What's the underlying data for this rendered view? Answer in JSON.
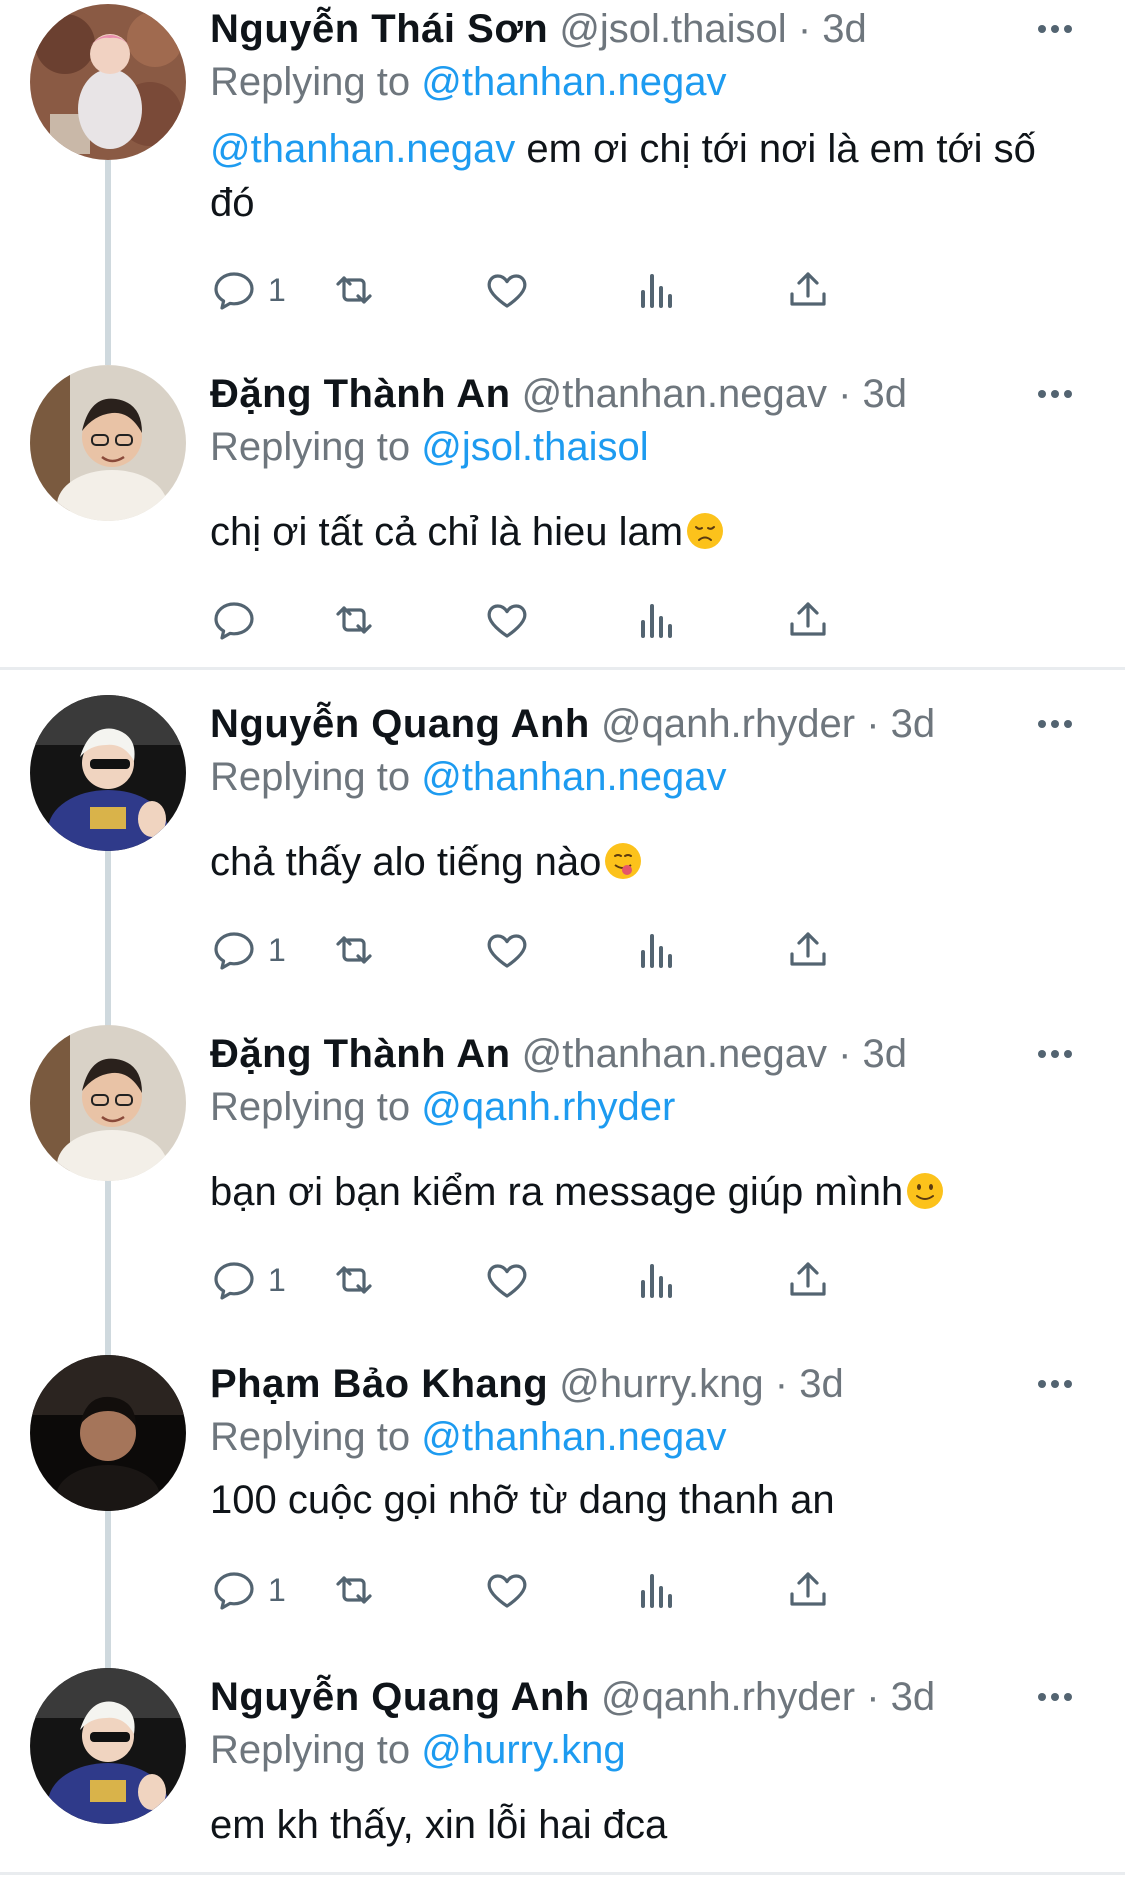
{
  "colors": {
    "accent": "#1d9bf0",
    "meta": "#6e767d",
    "thread_line": "#cfd9de"
  },
  "icons": {
    "reply": "reply-icon",
    "retweet": "retweet-icon",
    "like": "heart-icon",
    "views": "analytics-icon",
    "share": "share-icon",
    "more": "more-icon"
  },
  "replying_label": "Replying to",
  "tweets": [
    {
      "name": "Nguyễn Thái Sơn",
      "handle": "@jsol.thaisol",
      "sep": "·",
      "time": "3d",
      "reply_to": "@thanhan.negav",
      "body_mention": "@thanhan.negav",
      "body": " em ơi chị tới nơi là em tới số đó",
      "reply_count": "1"
    },
    {
      "name": "Đặng Thành An",
      "handle": "@thanhan.negav",
      "sep": "·",
      "time": "3d",
      "reply_to": "@jsol.thaisol",
      "body": "chị ơi tất cả chỉ là hieu lam",
      "emoji": "disappointed-face-emoji",
      "reply_count": ""
    },
    {
      "name": "Nguyễn Quang Anh",
      "handle": "@qanh.rhyder",
      "sep": "·",
      "time": "3d",
      "reply_to": "@thanhan.negav",
      "body": "chả thấy alo tiếng nào",
      "emoji": "tongue-out-face-emoji",
      "reply_count": "1"
    },
    {
      "name": "Đặng Thành An",
      "handle": "@thanhan.negav",
      "sep": "·",
      "time": "3d",
      "reply_to": "@qanh.rhyder",
      "body": "bạn ơi bạn kiểm ra message giúp mình",
      "emoji": "smiling-face-emoji",
      "reply_count": "1"
    },
    {
      "name": "Phạm Bảo Khang",
      "handle": "@hurry.kng",
      "sep": "·",
      "time": "3d",
      "reply_to": "@thanhan.negav",
      "body": "100 cuộc gọi nhỡ từ dang thanh an",
      "reply_count": "1"
    },
    {
      "name": "Nguyễn Quang Anh",
      "handle": "@qanh.rhyder",
      "sep": "·",
      "time": "3d",
      "reply_to": "@hurry.kng",
      "body": "em kh thấy, xin lỗi hai đca"
    }
  ]
}
